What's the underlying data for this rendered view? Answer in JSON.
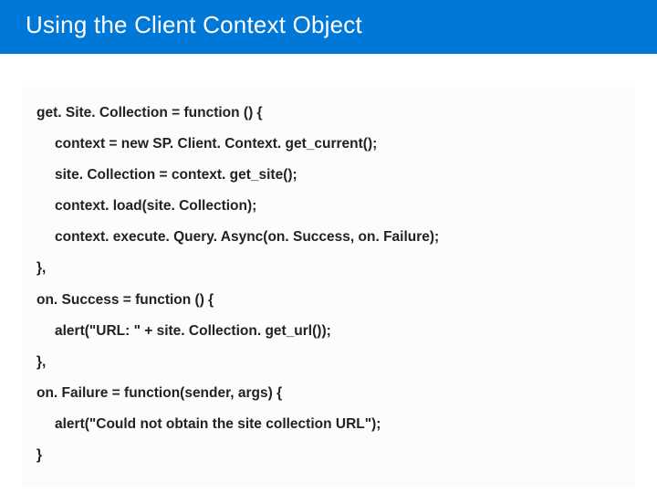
{
  "header": {
    "title": "Using the Client Context Object"
  },
  "code": {
    "lines": [
      {
        "text": "get. Site. Collection = function () {",
        "indent": false
      },
      {
        "text": "context = new SP. Client. Context. get_current();",
        "indent": true
      },
      {
        "text": "site. Collection = context. get_site();",
        "indent": true
      },
      {
        "text": "context. load(site. Collection);",
        "indent": true
      },
      {
        "text": "context. execute. Query. Async(on. Success, on. Failure);",
        "indent": true
      },
      {
        "text": "},",
        "indent": false
      },
      {
        "text": "on. Success = function () {",
        "indent": false
      },
      {
        "text": "alert(\"URL: \" + site. Collection. get_url());",
        "indent": true
      },
      {
        "text": "},",
        "indent": false
      },
      {
        "text": "on. Failure = function(sender, args) {",
        "indent": false
      },
      {
        "text": "alert(\"Could not obtain the site collection URL\");",
        "indent": true
      },
      {
        "text": "}",
        "indent": false
      }
    ]
  }
}
